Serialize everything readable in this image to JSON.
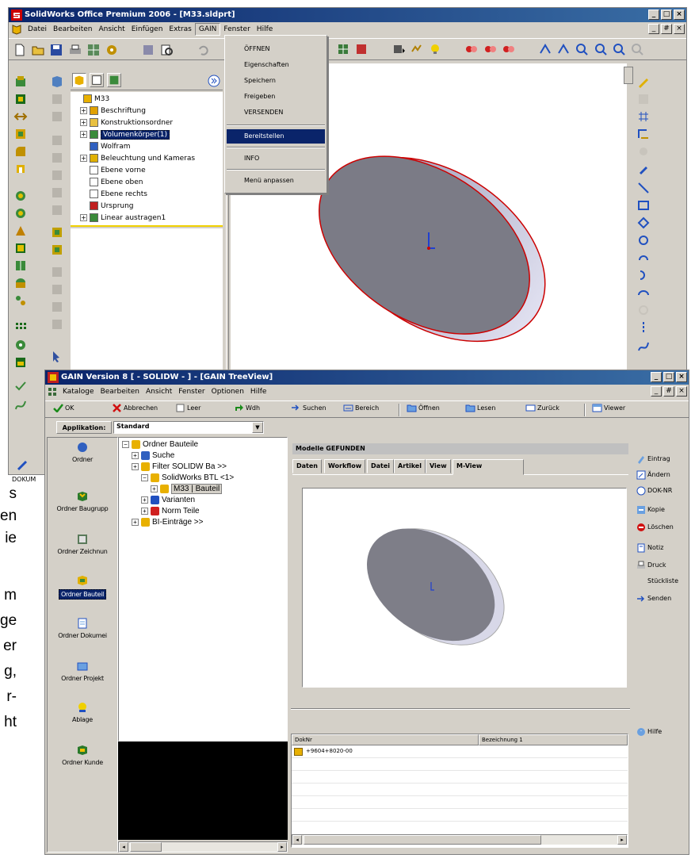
{
  "background_text": [
    "s",
    "en",
    "ie",
    "m",
    "ge",
    "er",
    "g,",
    "r-",
    "ht"
  ],
  "sw": {
    "title": "SolidWorks Office Premium 2006 - [M33.sldprt]",
    "menu": [
      "Datei",
      "Bearbeiten",
      "Ansicht",
      "Einfügen",
      "Extras",
      "GAIN",
      "Fenster",
      "Hilfe"
    ],
    "tree": [
      {
        "label": "M33",
        "indent": 0,
        "plus": false,
        "icon": "part-icon"
      },
      {
        "label": "Beschriftung",
        "indent": 1,
        "plus": true,
        "icon": "annotation-icon"
      },
      {
        "label": "Konstruktionsordner",
        "indent": 1,
        "plus": true,
        "icon": "folder-icon"
      },
      {
        "label": "Volumenkörper(1)",
        "indent": 1,
        "plus": true,
        "icon": "solid-body-icon",
        "selected": true
      },
      {
        "label": "Wolfram",
        "indent": 1,
        "plus": false,
        "icon": "material-icon"
      },
      {
        "label": "Beleuchtung und Kameras",
        "indent": 1,
        "plus": true,
        "icon": "lights-icon"
      },
      {
        "label": "Ebene vorne",
        "indent": 1,
        "plus": false,
        "icon": "plane-icon"
      },
      {
        "label": "Ebene oben",
        "indent": 1,
        "plus": false,
        "icon": "plane-icon"
      },
      {
        "label": "Ebene rechts",
        "indent": 1,
        "plus": false,
        "icon": "plane-icon"
      },
      {
        "label": "Ursprung",
        "indent": 1,
        "plus": false,
        "icon": "origin-icon"
      },
      {
        "label": "Linear austragen1",
        "indent": 1,
        "plus": true,
        "icon": "extrude-icon"
      }
    ],
    "gain_menu": [
      "ÖFFNEN",
      "Eigenschaften",
      "Speichern",
      "Freigeben",
      "VERSENDEN",
      "Bereitstellen",
      "INFO",
      "Menü anpassen"
    ],
    "gain_menu_selected": "Bereitstellen",
    "status_fragment": "DOKUM"
  },
  "gain": {
    "title": "GAIN Version 8   [ - SOLIDW - ] - [GAIN TreeView]",
    "menu": [
      "Kataloge",
      "Bearbeiten",
      "Ansicht",
      "Fenster",
      "Optionen",
      "Hilfe"
    ],
    "toolbar": [
      "OK",
      "Abbrechen",
      "Leer",
      "Wdh",
      "Suchen",
      "Bereich",
      "Öffnen",
      "Lesen",
      "Zurück",
      "Viewer"
    ],
    "application_label": "Applikation:",
    "application_value": "Standard",
    "nav": [
      "Ordner",
      "Ordner Baugrupp",
      "Ordner Zeichnun",
      "Ordner Bauteil",
      "Ordner Dokumei",
      "Ordner Projekt",
      "Ablage",
      "Ordner Kunde"
    ],
    "nav_selected": "Ordner Bauteil",
    "tree": [
      {
        "label": "Ordner Bauteile",
        "indent": 0,
        "plus": true
      },
      {
        "label": "Suche",
        "indent": 1,
        "plus": true
      },
      {
        "label": "Filter SOLIDW Ba >>",
        "indent": 1,
        "plus": true
      },
      {
        "label": "SolidWorks BTL <1>",
        "indent": 2,
        "plus": true
      },
      {
        "label": "M33 | Bauteil",
        "indent": 3,
        "plus": true,
        "selected": true
      },
      {
        "label": "Varianten",
        "indent": 2,
        "plus": true
      },
      {
        "label": "Norm Teile",
        "indent": 2,
        "plus": true
      },
      {
        "label": "BI-Einträge >>",
        "indent": 1,
        "plus": true
      }
    ],
    "panel_title": "Modelle GEFUNDEN",
    "tabs": [
      "Daten",
      "Workflow",
      "Datei",
      "Artikel",
      "View",
      "M-View"
    ],
    "active_tab": "M-View",
    "right_buttons": [
      "Eintrag",
      "Ändern",
      "DOK-NR",
      "Kopie",
      "Löschen",
      "Notiz",
      "Druck",
      "Stückliste",
      "Senden"
    ],
    "help_label": "Hilfe",
    "list_headers": [
      "DokNr",
      "Bezeichnung 1"
    ],
    "list_rows": [
      [
        "+9604+8020-00",
        ""
      ]
    ]
  }
}
